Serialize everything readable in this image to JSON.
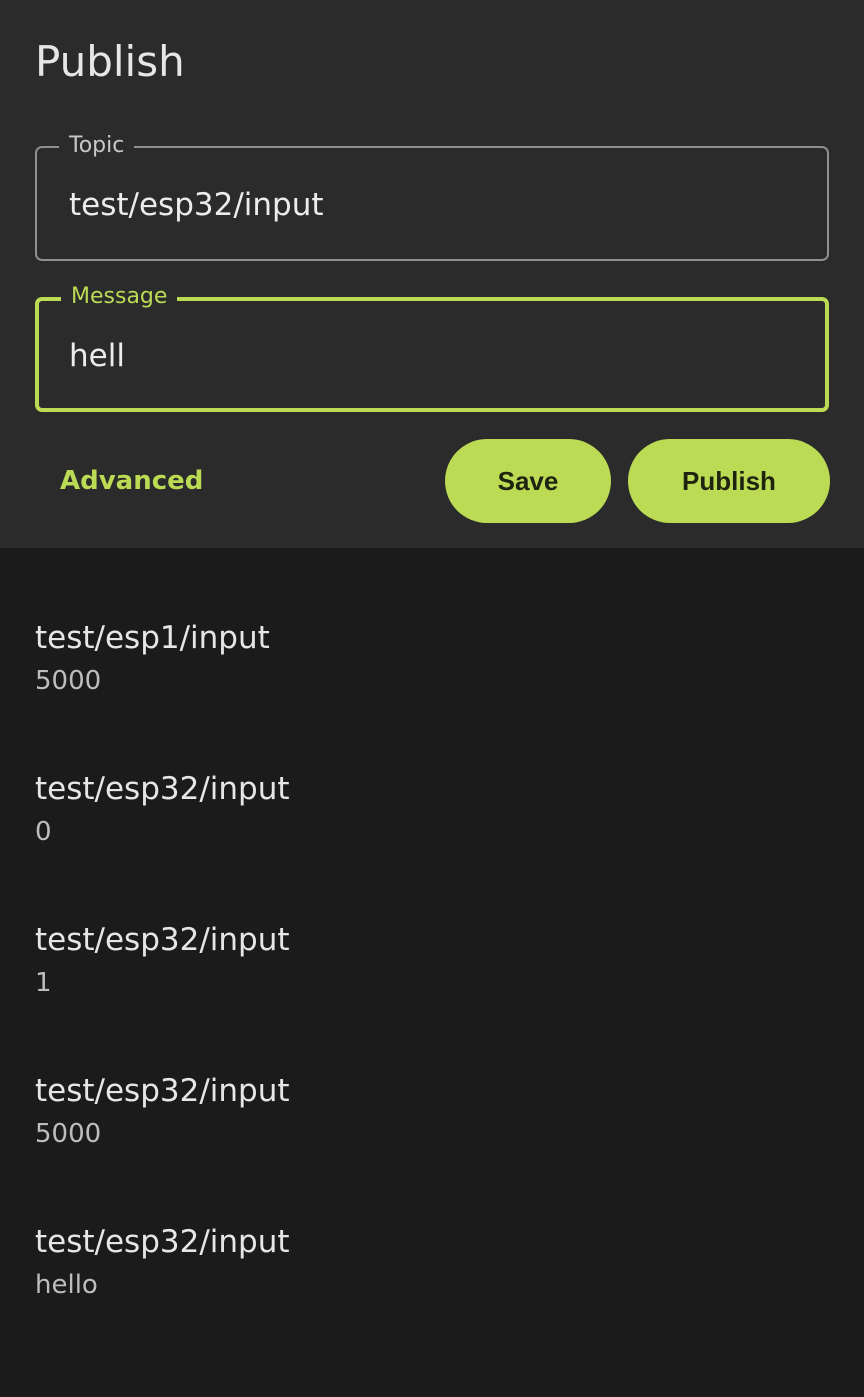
{
  "header": {
    "title": "Publish"
  },
  "form": {
    "topic": {
      "label": "Topic",
      "value": "test/esp32/input"
    },
    "message": {
      "label": "Message",
      "value": "hell"
    },
    "advanced_label": "Advanced",
    "save_label": "Save",
    "publish_label": "Publish"
  },
  "messages": [
    {
      "topic": "test/esp1/input",
      "payload": "5000"
    },
    {
      "topic": "test/esp32/input",
      "payload": "0"
    },
    {
      "topic": "test/esp32/input",
      "payload": "1"
    },
    {
      "topic": "test/esp32/input",
      "payload": "5000"
    },
    {
      "topic": "test/esp32/input",
      "payload": "hello"
    }
  ],
  "colors": {
    "accent": "#bcdb55",
    "panel": "#2b2b2b",
    "background": "#1b1b1b"
  }
}
